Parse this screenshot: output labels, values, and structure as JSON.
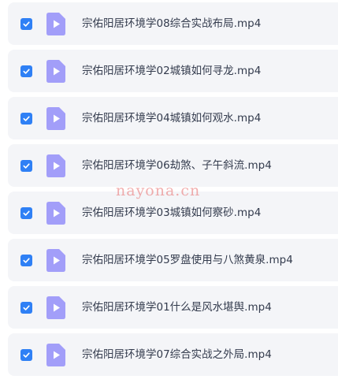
{
  "files": [
    {
      "name": "宗佑阳居环境学08综合实战布局.mp4",
      "checked": true
    },
    {
      "name": "宗佑阳居环境学02城镇如何寻龙.mp4",
      "checked": true
    },
    {
      "name": "宗佑阳居环境学04城镇如何观水.mp4",
      "checked": true
    },
    {
      "name": "宗佑阳居环境学06劫煞、子午斜流.mp4",
      "checked": true
    },
    {
      "name": "宗佑阳居环境学03城镇如何察砂.mp4",
      "checked": true
    },
    {
      "name": "宗佑阳居环境学05罗盘使用与八煞黄泉.mp4",
      "checked": true
    },
    {
      "name": "宗佑阳居环境学01什么是风水堪舆.mp4",
      "checked": true
    },
    {
      "name": "宗佑阳居环境学07综合实战之外局.mp4",
      "checked": true
    }
  ],
  "watermark": "nayona.cn",
  "colors": {
    "checkbox": "#2f80f5",
    "file_icon": "#a29ef9",
    "row_background": "#f4f5f8",
    "text": "#333b4d",
    "watermark": "#e86b6b"
  },
  "icons": {
    "checkbox": "check-icon",
    "file": "video-file-icon"
  }
}
